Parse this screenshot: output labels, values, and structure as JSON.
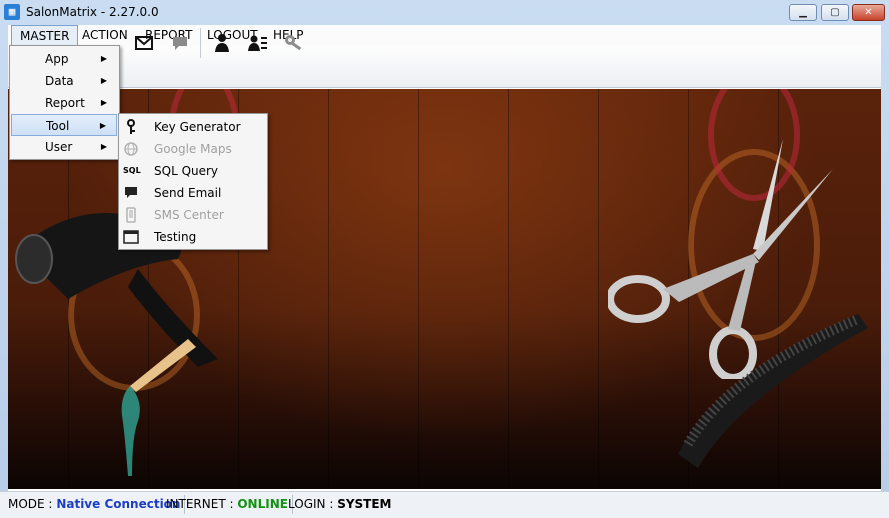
{
  "window": {
    "title": "SalonMatrix - 2.27.0.0"
  },
  "menubar": {
    "items": [
      "MASTER",
      "ACTION",
      "REPORT",
      "LOGOUT",
      "HELP"
    ]
  },
  "master_menu": {
    "items": [
      "App",
      "Data",
      "Report",
      "Tool",
      "User"
    ]
  },
  "tool_submenu": {
    "items": [
      {
        "label": "Key Generator",
        "icon": "key-icon",
        "enabled": true
      },
      {
        "label": "Google Maps",
        "icon": "globe-icon",
        "enabled": false
      },
      {
        "label": "SQL Query",
        "icon": "sql-icon",
        "enabled": true
      },
      {
        "label": "Send Email",
        "icon": "chat-bubble-icon",
        "enabled": true
      },
      {
        "label": "SMS Center",
        "icon": "phone-icon",
        "enabled": false
      },
      {
        "label": "Testing",
        "icon": "window-icon",
        "enabled": true
      }
    ],
    "sql_glyph": "SQL"
  },
  "toolbar": {
    "icons": [
      "mail-icon",
      "chat-icon",
      "user-icon",
      "user-list-icon",
      "key-icon"
    ]
  },
  "statusbar": {
    "mode_label": "MODE :",
    "mode_value": "Native Connection",
    "internet_label": "INTERNET :",
    "internet_value": "ONLINE",
    "login_label": "LOGIN :",
    "login_value": "SYSTEM"
  },
  "colors": {
    "mode_value": "#1c3ec4",
    "internet_value": "#129112",
    "wood": "#4a1c0a"
  }
}
